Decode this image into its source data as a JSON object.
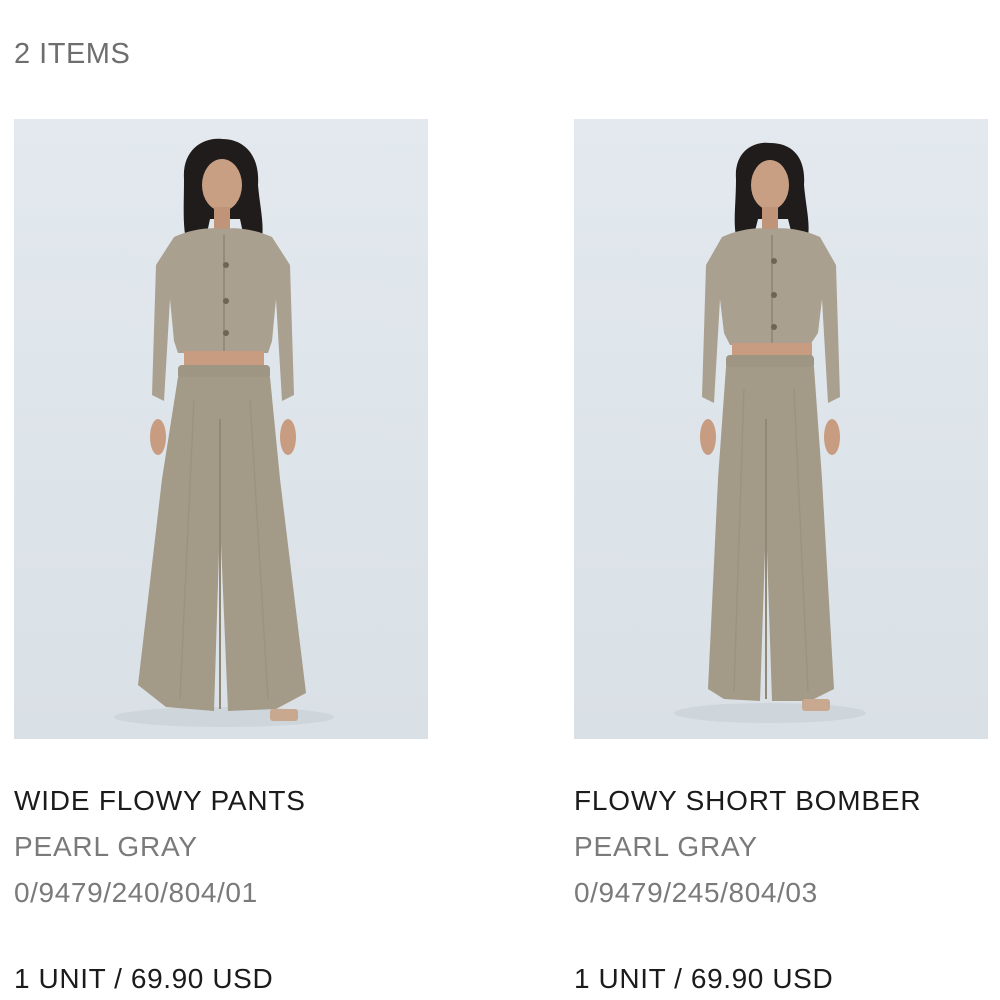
{
  "cart": {
    "item_count_label": "2 ITEMS"
  },
  "products": [
    {
      "name": "WIDE FLOWY PANTS",
      "color": "PEARL GRAY",
      "reference": "0/9479/240/804/01",
      "price_line": "1 UNIT / 69.90 USD",
      "image_label": "model-photo"
    },
    {
      "name": "FLOWY SHORT BOMBER",
      "color": "PEARL GRAY",
      "reference": "0/9479/245/804/03",
      "price_line": "1 UNIT / 69.90 USD",
      "image_label": "model-photo"
    }
  ],
  "colors": {
    "background": "#ffffff",
    "photo_backdrop": "#e0e7ec",
    "garment": "#a9a08f",
    "text_primary": "#1b1b1b",
    "text_secondary": "#7a7a7a"
  }
}
